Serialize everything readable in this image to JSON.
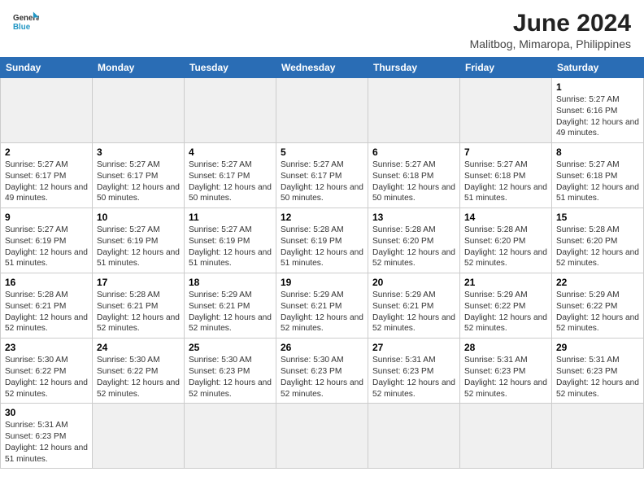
{
  "header": {
    "logo_line1": "General",
    "logo_line2": "Blue",
    "month_title": "June 2024",
    "subtitle": "Malitbog, Mimaropa, Philippines"
  },
  "days_of_week": [
    "Sunday",
    "Monday",
    "Tuesday",
    "Wednesday",
    "Thursday",
    "Friday",
    "Saturday"
  ],
  "weeks": [
    [
      {
        "day": "",
        "empty": true
      },
      {
        "day": "",
        "empty": true
      },
      {
        "day": "",
        "empty": true
      },
      {
        "day": "",
        "empty": true
      },
      {
        "day": "",
        "empty": true
      },
      {
        "day": "",
        "empty": true
      },
      {
        "day": "1",
        "sunrise": "5:27 AM",
        "sunset": "6:16 PM",
        "daylight": "12 hours and 49 minutes."
      }
    ],
    [
      {
        "day": "2",
        "sunrise": "5:27 AM",
        "sunset": "6:17 PM",
        "daylight": "12 hours and 49 minutes."
      },
      {
        "day": "3",
        "sunrise": "5:27 AM",
        "sunset": "6:17 PM",
        "daylight": "12 hours and 50 minutes."
      },
      {
        "day": "4",
        "sunrise": "5:27 AM",
        "sunset": "6:17 PM",
        "daylight": "12 hours and 50 minutes."
      },
      {
        "day": "5",
        "sunrise": "5:27 AM",
        "sunset": "6:17 PM",
        "daylight": "12 hours and 50 minutes."
      },
      {
        "day": "6",
        "sunrise": "5:27 AM",
        "sunset": "6:18 PM",
        "daylight": "12 hours and 50 minutes."
      },
      {
        "day": "7",
        "sunrise": "5:27 AM",
        "sunset": "6:18 PM",
        "daylight": "12 hours and 51 minutes."
      },
      {
        "day": "8",
        "sunrise": "5:27 AM",
        "sunset": "6:18 PM",
        "daylight": "12 hours and 51 minutes."
      }
    ],
    [
      {
        "day": "9",
        "sunrise": "5:27 AM",
        "sunset": "6:19 PM",
        "daylight": "12 hours and 51 minutes."
      },
      {
        "day": "10",
        "sunrise": "5:27 AM",
        "sunset": "6:19 PM",
        "daylight": "12 hours and 51 minutes."
      },
      {
        "day": "11",
        "sunrise": "5:27 AM",
        "sunset": "6:19 PM",
        "daylight": "12 hours and 51 minutes."
      },
      {
        "day": "12",
        "sunrise": "5:28 AM",
        "sunset": "6:19 PM",
        "daylight": "12 hours and 51 minutes."
      },
      {
        "day": "13",
        "sunrise": "5:28 AM",
        "sunset": "6:20 PM",
        "daylight": "12 hours and 52 minutes."
      },
      {
        "day": "14",
        "sunrise": "5:28 AM",
        "sunset": "6:20 PM",
        "daylight": "12 hours and 52 minutes."
      },
      {
        "day": "15",
        "sunrise": "5:28 AM",
        "sunset": "6:20 PM",
        "daylight": "12 hours and 52 minutes."
      }
    ],
    [
      {
        "day": "16",
        "sunrise": "5:28 AM",
        "sunset": "6:21 PM",
        "daylight": "12 hours and 52 minutes."
      },
      {
        "day": "17",
        "sunrise": "5:28 AM",
        "sunset": "6:21 PM",
        "daylight": "12 hours and 52 minutes."
      },
      {
        "day": "18",
        "sunrise": "5:29 AM",
        "sunset": "6:21 PM",
        "daylight": "12 hours and 52 minutes."
      },
      {
        "day": "19",
        "sunrise": "5:29 AM",
        "sunset": "6:21 PM",
        "daylight": "12 hours and 52 minutes."
      },
      {
        "day": "20",
        "sunrise": "5:29 AM",
        "sunset": "6:21 PM",
        "daylight": "12 hours and 52 minutes."
      },
      {
        "day": "21",
        "sunrise": "5:29 AM",
        "sunset": "6:22 PM",
        "daylight": "12 hours and 52 minutes."
      },
      {
        "day": "22",
        "sunrise": "5:29 AM",
        "sunset": "6:22 PM",
        "daylight": "12 hours and 52 minutes."
      }
    ],
    [
      {
        "day": "23",
        "sunrise": "5:30 AM",
        "sunset": "6:22 PM",
        "daylight": "12 hours and 52 minutes."
      },
      {
        "day": "24",
        "sunrise": "5:30 AM",
        "sunset": "6:22 PM",
        "daylight": "12 hours and 52 minutes."
      },
      {
        "day": "25",
        "sunrise": "5:30 AM",
        "sunset": "6:23 PM",
        "daylight": "12 hours and 52 minutes."
      },
      {
        "day": "26",
        "sunrise": "5:30 AM",
        "sunset": "6:23 PM",
        "daylight": "12 hours and 52 minutes."
      },
      {
        "day": "27",
        "sunrise": "5:31 AM",
        "sunset": "6:23 PM",
        "daylight": "12 hours and 52 minutes."
      },
      {
        "day": "28",
        "sunrise": "5:31 AM",
        "sunset": "6:23 PM",
        "daylight": "12 hours and 52 minutes."
      },
      {
        "day": "29",
        "sunrise": "5:31 AM",
        "sunset": "6:23 PM",
        "daylight": "12 hours and 52 minutes."
      }
    ],
    [
      {
        "day": "30",
        "sunrise": "5:31 AM",
        "sunset": "6:23 PM",
        "daylight": "12 hours and 51 minutes."
      },
      {
        "day": "",
        "empty": true
      },
      {
        "day": "",
        "empty": true
      },
      {
        "day": "",
        "empty": true
      },
      {
        "day": "",
        "empty": true
      },
      {
        "day": "",
        "empty": true
      },
      {
        "day": "",
        "empty": true
      }
    ]
  ]
}
